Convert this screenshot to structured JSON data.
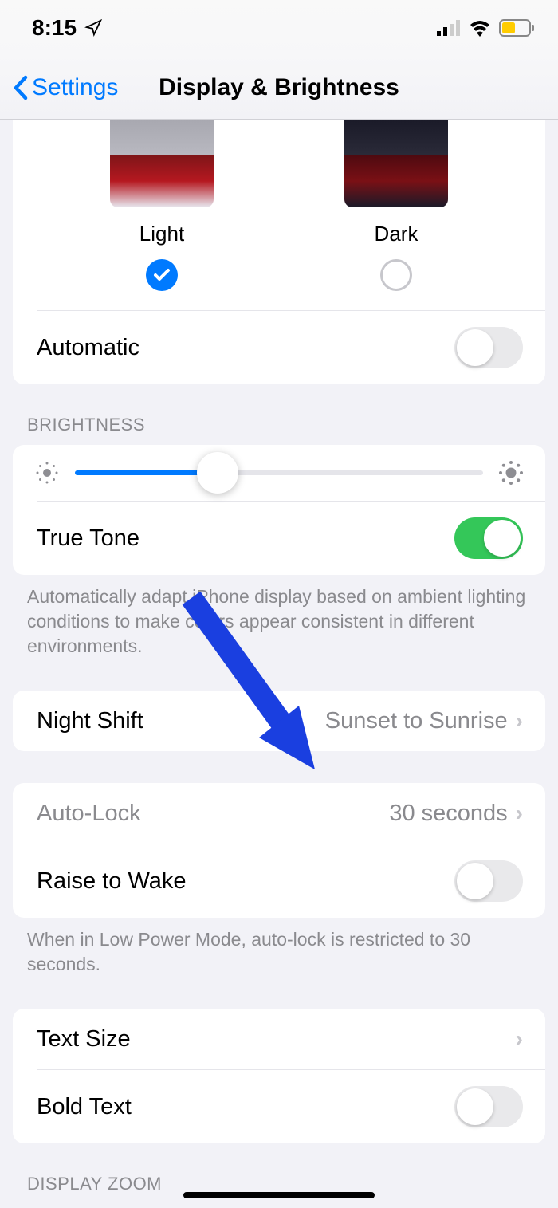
{
  "status": {
    "time": "8:15"
  },
  "nav": {
    "back": "Settings",
    "title": "Display & Brightness"
  },
  "appearance": {
    "light_label": "Light",
    "dark_label": "Dark",
    "selected": "light",
    "automatic_label": "Automatic",
    "automatic_on": false
  },
  "brightness": {
    "header": "BRIGHTNESS",
    "value_pct": 35,
    "true_tone_label": "True Tone",
    "true_tone_on": true,
    "footer": "Automatically adapt iPhone display based on ambient lighting conditions to make colors appear consistent in different environments."
  },
  "night_shift": {
    "label": "Night Shift",
    "value": "Sunset to Sunrise"
  },
  "auto_lock": {
    "label": "Auto-Lock",
    "value": "30 seconds",
    "raise_label": "Raise to Wake",
    "raise_on": false,
    "footer": "When in Low Power Mode, auto-lock is restricted to 30 seconds."
  },
  "text": {
    "size_label": "Text Size",
    "bold_label": "Bold Text",
    "bold_on": false
  },
  "display_zoom": {
    "header": "DISPLAY ZOOM"
  },
  "colors": {
    "accent": "#007aff",
    "arrow": "#1a3fe0"
  }
}
